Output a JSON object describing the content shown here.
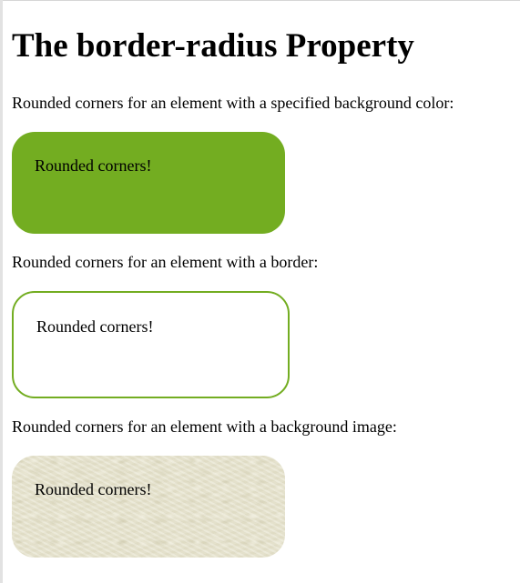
{
  "page": {
    "title": "The border-radius Property"
  },
  "sections": [
    {
      "description": "Rounded corners for an element with a specified background color:",
      "box_text": "Rounded corners!",
      "box_background": "#73AD21"
    },
    {
      "description": "Rounded corners for an element with a border:",
      "box_text": "Rounded corners!",
      "box_border_color": "#73AD21"
    },
    {
      "description": "Rounded corners for an element with a background image:",
      "box_text": "Rounded corners!"
    }
  ],
  "colors": {
    "accent_green": "#73AD21",
    "paper_texture": "#e7e4d0"
  }
}
